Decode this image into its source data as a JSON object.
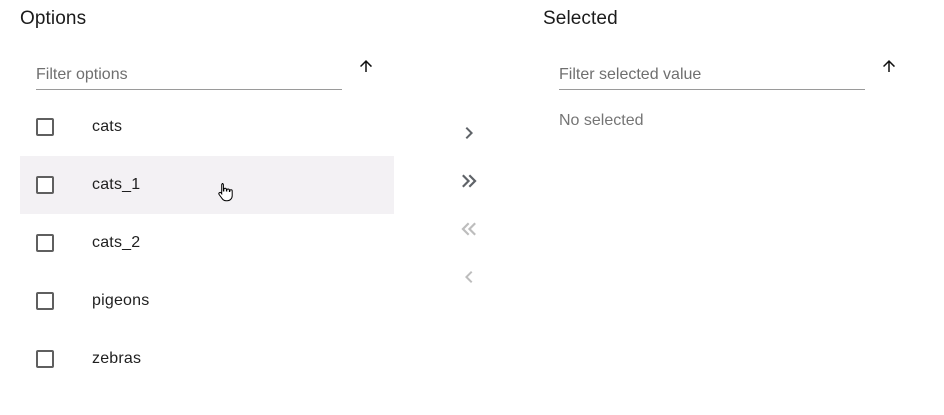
{
  "options_panel": {
    "title": "Options",
    "filter_placeholder": "Filter options",
    "sort_icon": "arrow-up-icon",
    "items": [
      {
        "label": "cats",
        "checked": false
      },
      {
        "label": "cats_1",
        "checked": false
      },
      {
        "label": "cats_2",
        "checked": false
      },
      {
        "label": "pigeons",
        "checked": false
      },
      {
        "label": "zebras",
        "checked": false
      }
    ]
  },
  "selected_panel": {
    "title": "Selected",
    "filter_placeholder": "Filter selected value",
    "sort_icon": "arrow-up-icon",
    "empty_text": "No selected"
  },
  "transfer_controls": [
    {
      "icon": "chevron-right-icon",
      "enabled": true
    },
    {
      "icon": "double-chevron-right-icon",
      "enabled": true
    },
    {
      "icon": "double-chevron-left-icon",
      "enabled": false
    },
    {
      "icon": "chevron-left-icon",
      "enabled": false
    }
  ],
  "colors": {
    "hover_row": "#f3f1f4",
    "enabled_icon": "#5f6368",
    "disabled_icon": "#bdbdbd"
  }
}
